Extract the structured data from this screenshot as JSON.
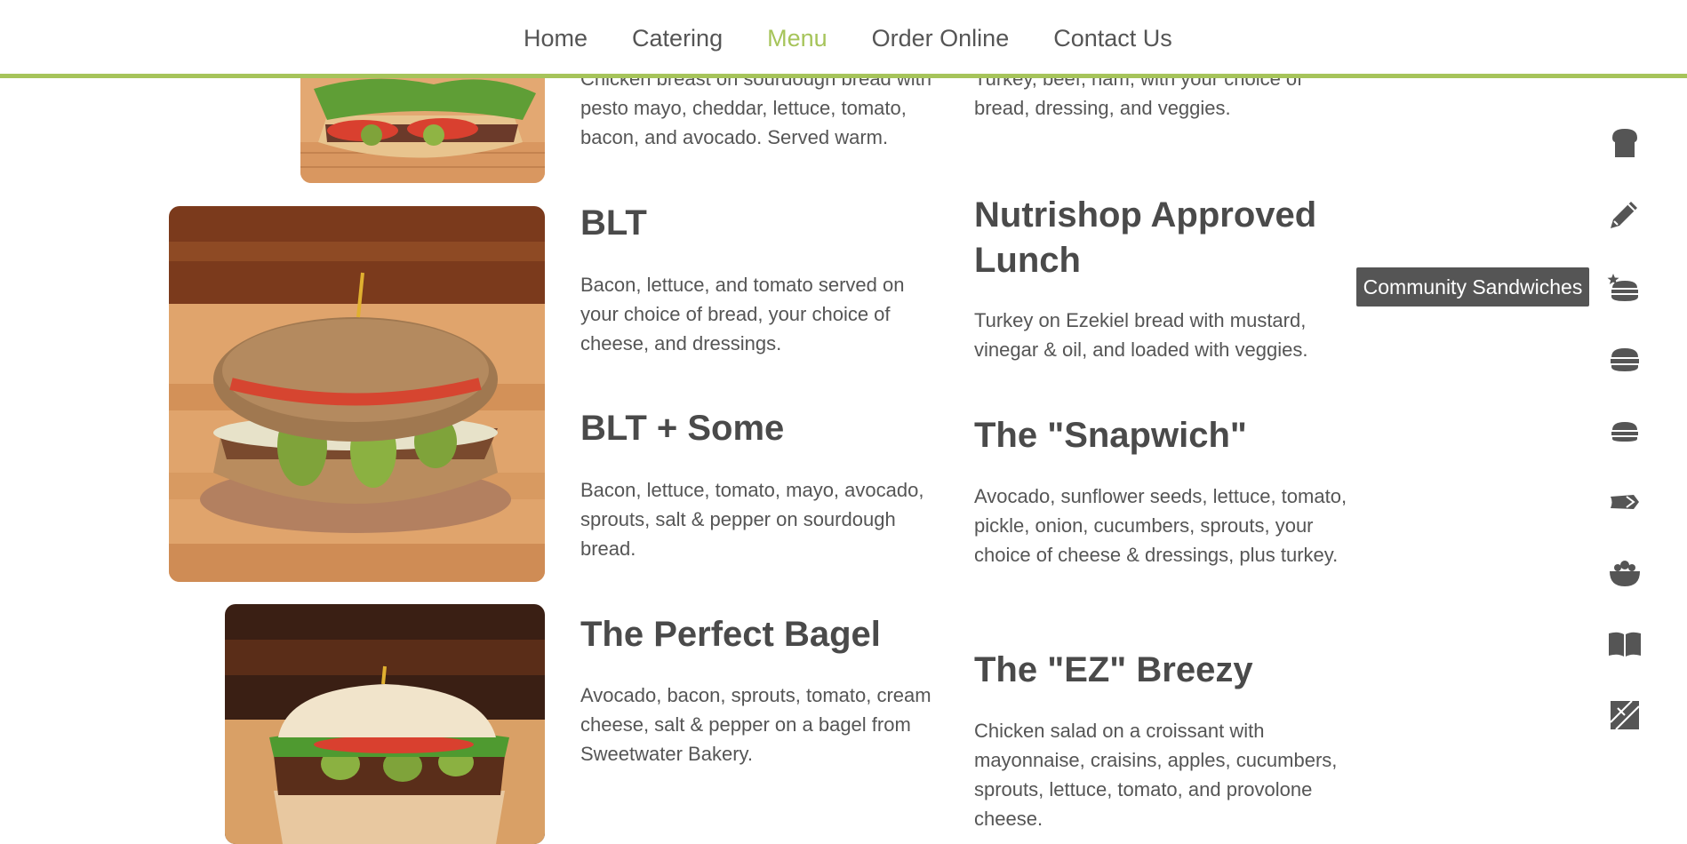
{
  "nav": {
    "items": [
      "Home",
      "Catering",
      "Menu",
      "Order Online",
      "Contact Us"
    ],
    "active": "Menu"
  },
  "colors": {
    "accent": "#a6c45a",
    "text": "#555555",
    "heading": "#4a4a4a",
    "icon": "#555555"
  },
  "menu": {
    "partial_left_desc": "Chicken breast on sourdough bread with pesto mayo, cheddar, lettuce, tomato, bacon, and avocado. Served warm.",
    "partial_right_desc": "Turkey, beef, ham, with your choice of bread, dressing, and veggies.",
    "blt": {
      "title": "BLT",
      "desc": "Bacon, lettuce, and tomato served on your choice of bread, your choice of cheese, and dressings."
    },
    "blt_some": {
      "title": "BLT + Some",
      "desc": "Bacon, lettuce, tomato, mayo, avocado, sprouts, salt & pepper on sourdough bread."
    },
    "perfect_bagel": {
      "title": "The Perfect Bagel",
      "desc": "Avocado, bacon, sprouts, tomato, cream cheese, salt & pepper on a bagel from Sweetwater Bakery."
    },
    "nutrishop": {
      "title": "Nutrishop Approved Lunch",
      "desc": "Turkey on Ezekiel bread with mustard, vinegar & oil, and loaded with veggies."
    },
    "snapwich": {
      "title": "The \"Snapwich\"",
      "desc": "Avocado, sunflower seeds, lettuce, tomato, pickle, onion, cucumbers, sprouts, your choice of cheese & dressings, plus turkey."
    },
    "ez_breezy": {
      "title": "The \"EZ\" Breezy",
      "desc": "Chicken salad on a croissant with mayonnaise, craisins, apples, cucumbers, sprouts, lettuce, tomato, and provolone cheese."
    }
  },
  "side_nav": {
    "icons": [
      "bread-icon",
      "pencil-icon",
      "community-sandwich-icon",
      "burger-icon",
      "burger-small-icon",
      "wrap-icon",
      "salad-bowl-icon",
      "book-icon",
      "panini-icon"
    ],
    "tooltip": "Community Sandwiches"
  }
}
